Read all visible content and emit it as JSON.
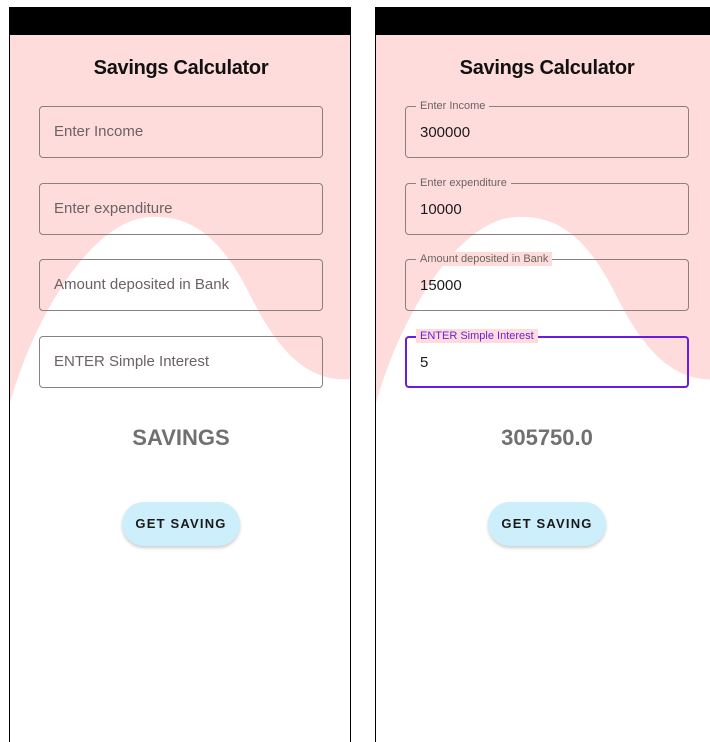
{
  "theme": {
    "wave_color": "#ffdcdc",
    "accent": "#6a1de0",
    "button_bg": "#cdeefb"
  },
  "screens": [
    {
      "title": "Savings Calculator",
      "fields": [
        {
          "placeholder": "Enter Income",
          "value": "",
          "label": ""
        },
        {
          "placeholder": "Enter expenditure",
          "value": "",
          "label": ""
        },
        {
          "placeholder": "Amount deposited in Bank",
          "value": "",
          "label": ""
        },
        {
          "placeholder": "ENTER Simple Interest",
          "value": "",
          "label": ""
        }
      ],
      "result": "SAVINGS",
      "button_label": "GET SAVING"
    },
    {
      "title": "Savings Calculator",
      "fields": [
        {
          "label": "Enter Income",
          "value": "300000"
        },
        {
          "label": "Enter expenditure",
          "value": "10000"
        },
        {
          "label": "Amount deposited in Bank",
          "value": "15000"
        },
        {
          "label": "ENTER Simple Interest",
          "value": "5"
        }
      ],
      "result": "305750.0",
      "button_label": "GET SAVING"
    }
  ]
}
